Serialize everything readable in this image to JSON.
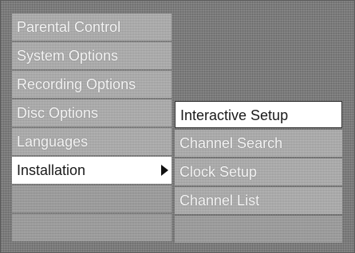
{
  "main_menu": {
    "items": [
      {
        "label": "Parental Control"
      },
      {
        "label": "System Options"
      },
      {
        "label": "Recording Options"
      },
      {
        "label": "Disc Options"
      },
      {
        "label": "Languages"
      },
      {
        "label": "Installation",
        "state": "active",
        "has_submenu": true
      }
    ]
  },
  "submenu": {
    "items": [
      {
        "label": "Interactive Setup",
        "state": "highlighted"
      },
      {
        "label": "Channel Search"
      },
      {
        "label": "Clock Setup"
      },
      {
        "label": "Channel List"
      }
    ]
  },
  "colors": {
    "background": "#7a7a7a",
    "menu_item": "#a6a6a6",
    "highlight": "#ffffff",
    "text": "#f4f4f4",
    "highlight_text": "#1a1a1a"
  }
}
